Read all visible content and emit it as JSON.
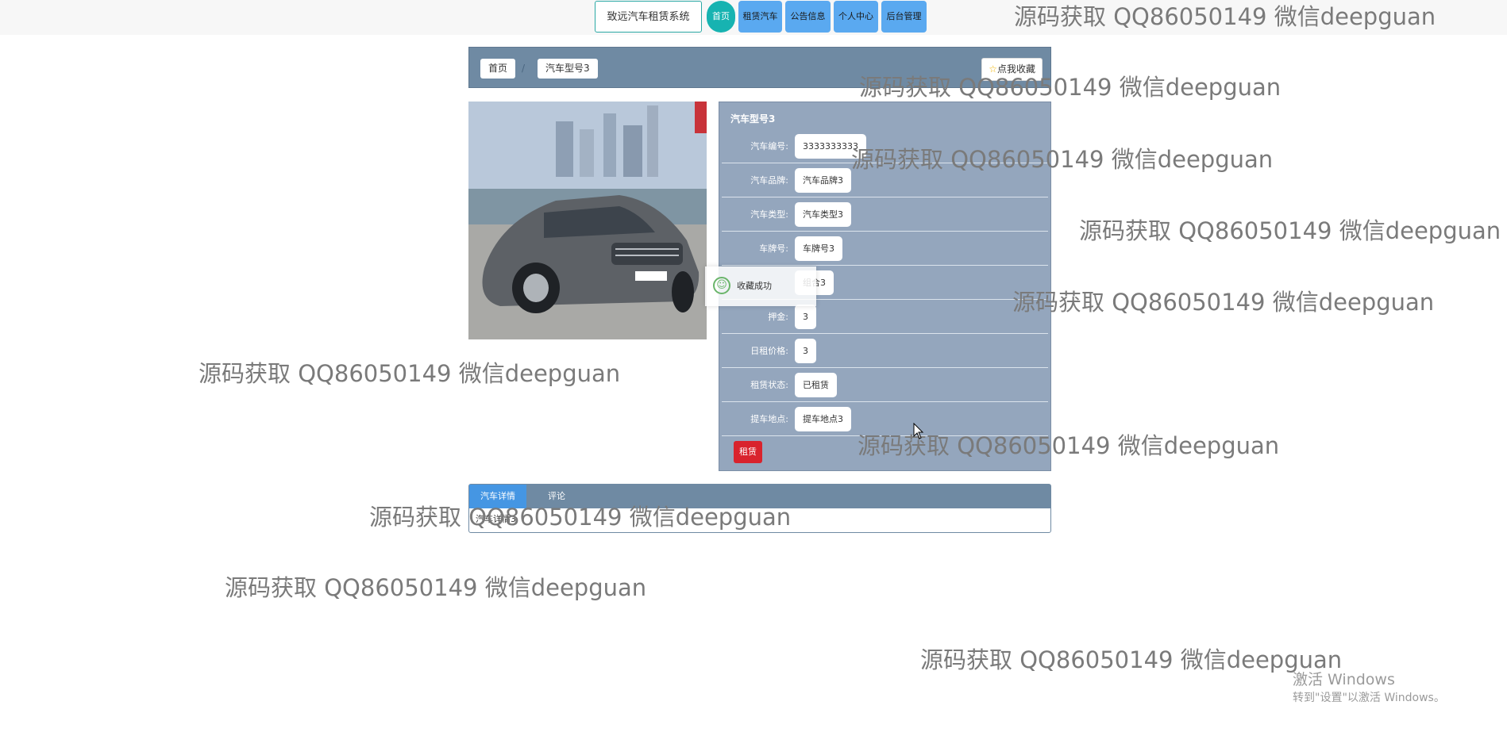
{
  "nav": {
    "brand": "致远汽车租赁系统",
    "items": [
      "首页",
      "租赁汽车",
      "公告信息",
      "个人中心",
      "后台管理"
    ]
  },
  "breadcrumb": {
    "home": "首页",
    "current": "汽车型号3",
    "favorite": "点我收藏"
  },
  "detail": {
    "title": "汽车型号3",
    "fields": [
      {
        "label": "汽车编号:",
        "value": "3333333333"
      },
      {
        "label": "汽车品牌:",
        "value": "汽车品牌3"
      },
      {
        "label": "汽车类型:",
        "value": "汽车类型3"
      },
      {
        "label": "车牌号:",
        "value": "车牌号3"
      },
      {
        "label": "",
        "value": "组合3"
      },
      {
        "label": "押金:",
        "value": "3"
      },
      {
        "label": "日租价格:",
        "value": "3"
      },
      {
        "label": "租赁状态:",
        "value": "已租赁"
      },
      {
        "label": "提车地点:",
        "value": "提车地点3"
      }
    ],
    "rent_button": "租赁"
  },
  "toast": {
    "text": "收藏成功"
  },
  "tabs": {
    "items": [
      "汽车详情",
      "评论"
    ],
    "content": "汽车详情3"
  },
  "watermark": "源码获取 QQ86050149 微信deepguan",
  "windows": {
    "line1": "激活 Windows",
    "line2": "转到\"设置\"以激活 Windows。"
  },
  "colors": {
    "nav_active": "#17b3b1",
    "nav_item": "#5aa9f0",
    "panel": "#94a6bd",
    "bar": "#6f8aa3",
    "rent_button": "#d9232d",
    "tab_active": "#4596e3"
  }
}
